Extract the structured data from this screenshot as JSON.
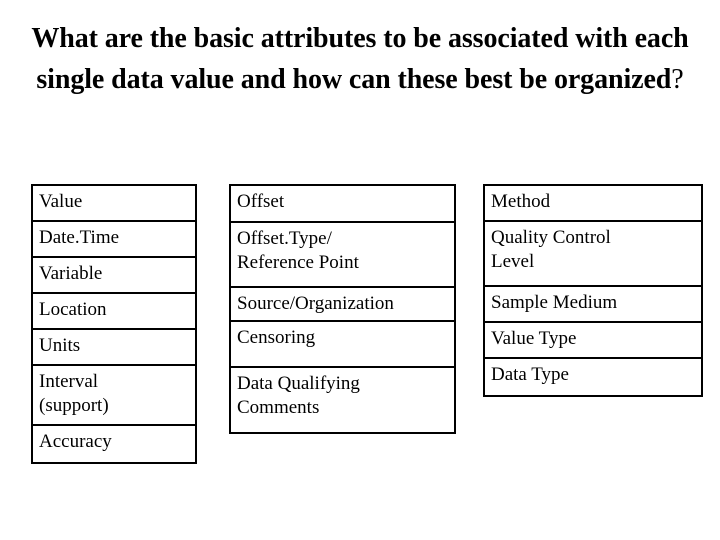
{
  "slide": {
    "title_line1": "What are the basic attributes to be",
    "title_line2": "associated with each single data value and",
    "title_line3": "how can these best be organized",
    "title_question_mark": "?"
  },
  "tables": {
    "column1": {
      "name": "value-attributes",
      "rows": [
        "Value",
        "Date.Time",
        "Variable",
        "Location",
        "Units",
        "Interval\n(support)",
        "Accuracy"
      ]
    },
    "column2": {
      "name": "offset-attributes",
      "rows": [
        "Offset",
        "Offset.Type/\nReference Point",
        "Source/Organization",
        "Censoring",
        "Data Qualifying\nComments"
      ]
    },
    "column3": {
      "name": "method-attributes",
      "rows": [
        "Method",
        "Quality Control\nLevel",
        "Sample Medium",
        "Value Type",
        "Data Type"
      ]
    }
  },
  "colors": {
    "background": "#ffffff",
    "text": "#000000",
    "border": "#000000"
  }
}
